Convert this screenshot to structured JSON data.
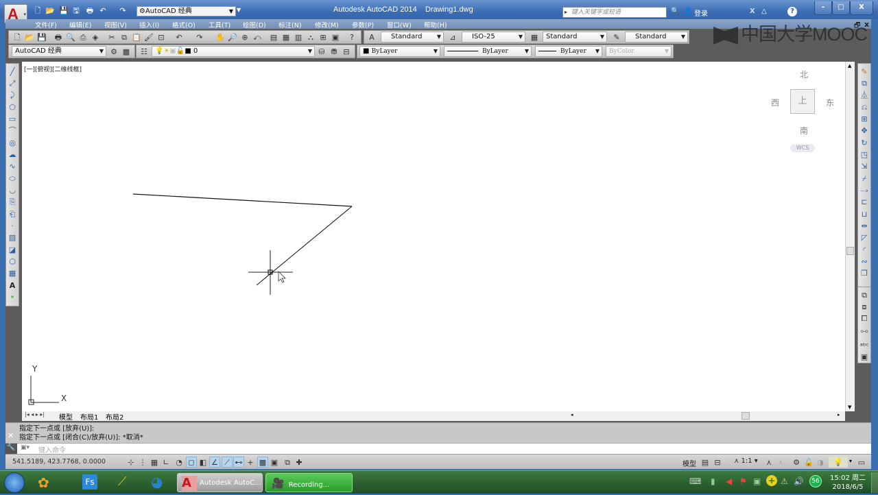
{
  "window": {
    "app_title": "Autodesk AutoCAD 2014",
    "doc_name": "Drawing1.dwg",
    "workspace": "AutoCAD 经典",
    "search_placeholder": "键入关键字或短语",
    "login": "登录",
    "help_glyph": "?"
  },
  "menu": [
    "文件(F)",
    "编辑(E)",
    "视图(V)",
    "插入(I)",
    "格式(O)",
    "工具(T)",
    "绘图(D)",
    "标注(N)",
    "修改(M)",
    "参数(P)",
    "窗口(W)",
    "帮助(H)"
  ],
  "styles_toolbar": {
    "text_style": "Standard",
    "dim_style": "ISO-25",
    "table_style": "Standard",
    "mleader_style": "Standard"
  },
  "layers_toolbar": {
    "workspace": "AutoCAD 经典",
    "current_layer": "0"
  },
  "properties_toolbar": {
    "color": "ByLayer",
    "linetype": "ByLayer",
    "lineweight": "ByLayer",
    "plotstyle": "ByColor"
  },
  "watermark": "中国大学MOOC",
  "viewport": {
    "label": "[一][俯视][二维线框]",
    "viewcube": {
      "north": "北",
      "south": "南",
      "east": "东",
      "west": "西",
      "face": "上",
      "wcs": "WCS"
    },
    "ucs": {
      "x": "X",
      "y": "Y"
    }
  },
  "layout_tabs": [
    "模型",
    "布局1",
    "布局2"
  ],
  "command": {
    "history": [
      "指定下一点或 [放弃(U)]:",
      "指定下一点或 [闭合(C)/放弃(U)]: *取消*"
    ],
    "placeholder": "键入命令"
  },
  "status": {
    "coordinates": "541.5189,  423.7768, 0.0000",
    "model_label": "模型",
    "annotation_scale": "1:1"
  },
  "taskbar": {
    "items": [
      "Autodesk AutoC...",
      "Recording..."
    ],
    "time": "15:02 周二",
    "date": "2018/6/5",
    "badge": "56"
  }
}
